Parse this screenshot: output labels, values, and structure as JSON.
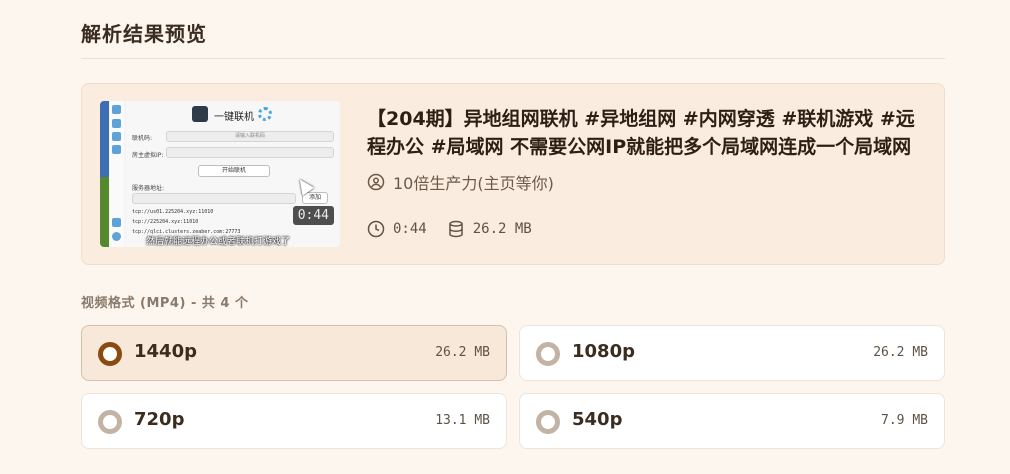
{
  "section_title": "解析结果预览",
  "video": {
    "title": "【204期】异地组网联机 #异地组网 #内网穿透 #联机游戏 #远程办公 #局域网 不需要公网IP就能把多个局域网连成一个局域网",
    "author": "10倍生产力(主页等你)",
    "duration": "0:44",
    "size": "26.2 MB",
    "thumbnail": {
      "header": "一键联机",
      "field1_label": "联机码:",
      "field1_placeholder": "请输入联机码",
      "field2_label": "房主虚拟IP:",
      "button": "开始联机",
      "server_label": "服务器地址:",
      "add_button": "添加",
      "log_lines": [
        "tcp://us01.225204.xyz:11010",
        "tcp://225204.xyz:11010",
        "tcp://qlci.clusters.zeaber.com:27773"
      ],
      "caption": "然后就能远程办公或者联机打游戏了",
      "duration_badge": "0:44"
    }
  },
  "formats": {
    "label": "视频格式 (MP4) - 共 4 个",
    "items": [
      {
        "label": "1440p",
        "size": "26.2 MB",
        "selected": true
      },
      {
        "label": "1080p",
        "size": "26.2 MB",
        "selected": false
      },
      {
        "label": "720p",
        "size": "13.1 MB",
        "selected": false
      },
      {
        "label": "540p",
        "size": "7.9 MB",
        "selected": false
      }
    ]
  },
  "colors": {
    "accent": "#8a4a10",
    "card_bg": "#fbece0",
    "page_bg": "#fdf6ee"
  },
  "icons": {
    "author": "user-circle-icon",
    "duration": "clock-icon",
    "size": "database-icon"
  }
}
